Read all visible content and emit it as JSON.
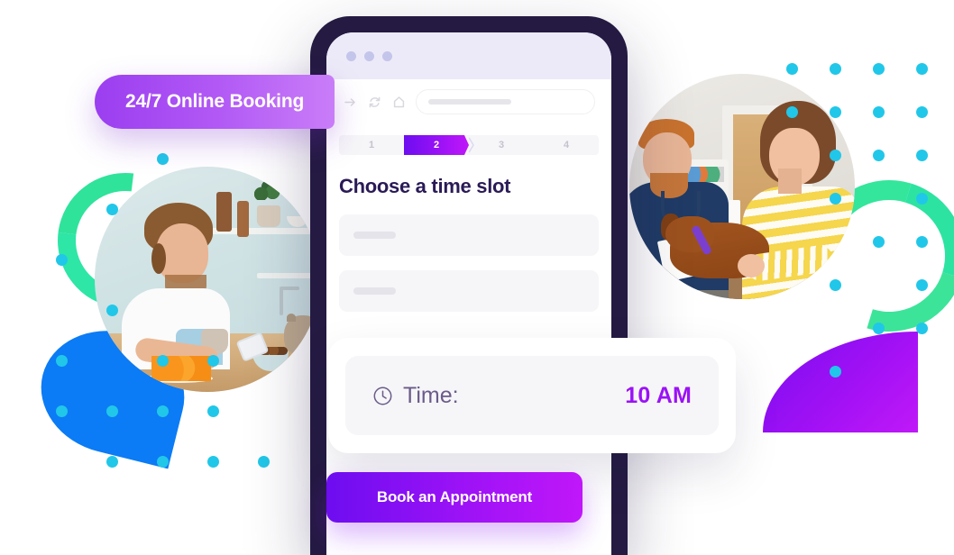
{
  "badge": {
    "label": "24/7 Online Booking",
    "gradient_from": "#9b3ef0",
    "gradient_to": "#c97df8"
  },
  "phone": {
    "frame_color": "#241a42",
    "browser": {
      "traffic_lights": [
        "dot-1",
        "dot-2",
        "dot-3"
      ],
      "nav_icons": [
        "forward-arrow-icon",
        "refresh-icon",
        "home-icon"
      ],
      "url_value": "",
      "url_placeholder": ""
    },
    "stepper": {
      "steps": [
        {
          "label": "1",
          "active": false
        },
        {
          "label": "2",
          "active": true
        },
        {
          "label": "3",
          "active": false
        },
        {
          "label": "4",
          "active": false
        }
      ],
      "active_index": 1,
      "active_color": "#9b12f6",
      "track_color": "#f6f6f8"
    },
    "screen": {
      "title": "Choose a time slot",
      "title_color": "#2a1a56",
      "skeleton_rows": [
        {
          "id": "field-1"
        },
        {
          "id": "field-2"
        }
      ]
    },
    "cta": {
      "label": "Book an Appointment",
      "gradient_from": "#6d0df0",
      "gradient_to": "#c017f9"
    }
  },
  "time_card": {
    "icon": "clock-icon",
    "label": "Time:",
    "value": "10 AM",
    "label_color": "#6b5b8a",
    "value_color": "#9b12f6"
  },
  "decorations": {
    "accent_cyan": "#21c7e8",
    "accent_green": "#2fe39a",
    "accent_blue": "#0b7cf5",
    "accent_purple": "#a411f5",
    "photos": [
      {
        "name": "man-with-phone-and-cat"
      },
      {
        "name": "vet-woman-and-dog"
      }
    ]
  }
}
